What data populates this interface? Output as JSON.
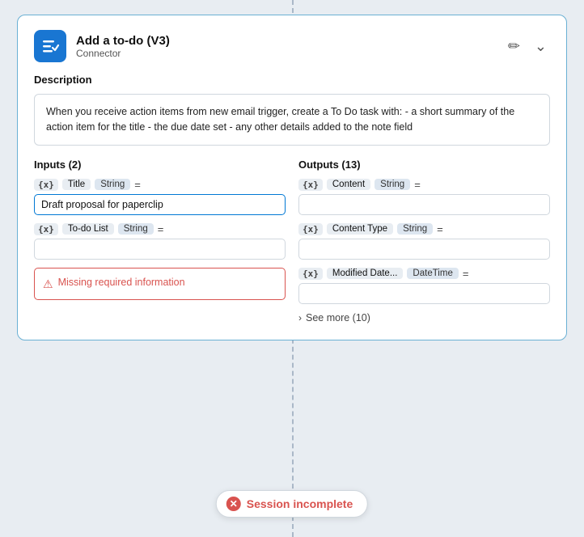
{
  "card": {
    "title": "Add a to-do (V3)",
    "subtitle": "Connector",
    "description": "When you receive action items from new email trigger, create a To Do task with: - a short summary of the action item for the title - the due date set - any other details added to the note field"
  },
  "inputs": {
    "section_title": "Inputs (2)",
    "fields": [
      {
        "icon": "{x}",
        "name": "Title",
        "type": "String",
        "equals": "=",
        "value": "Draft proposal for paperclip",
        "has_value": true,
        "has_error": false
      },
      {
        "icon": "{x}",
        "name": "To-do List",
        "type": "String",
        "equals": "=",
        "value": "",
        "has_value": false,
        "has_error": true,
        "error_text": "Missing required information"
      }
    ]
  },
  "outputs": {
    "section_title": "Outputs (13)",
    "fields": [
      {
        "icon": "{x}",
        "name": "Content",
        "type": "String",
        "equals": "=",
        "value": ""
      },
      {
        "icon": "{x}",
        "name": "Content Type",
        "type": "String",
        "equals": "=",
        "value": ""
      },
      {
        "icon": "{x}",
        "name": "Modified Date...",
        "type": "DateTime",
        "equals": "=",
        "value": ""
      }
    ],
    "see_more_label": "See more (10)"
  },
  "session_badge": {
    "text": "Session incomplete"
  },
  "icons": {
    "edit": "✏",
    "chevron_down": "⌄",
    "chevron_right": "›",
    "error": "⚠",
    "x_circle": "✕"
  }
}
